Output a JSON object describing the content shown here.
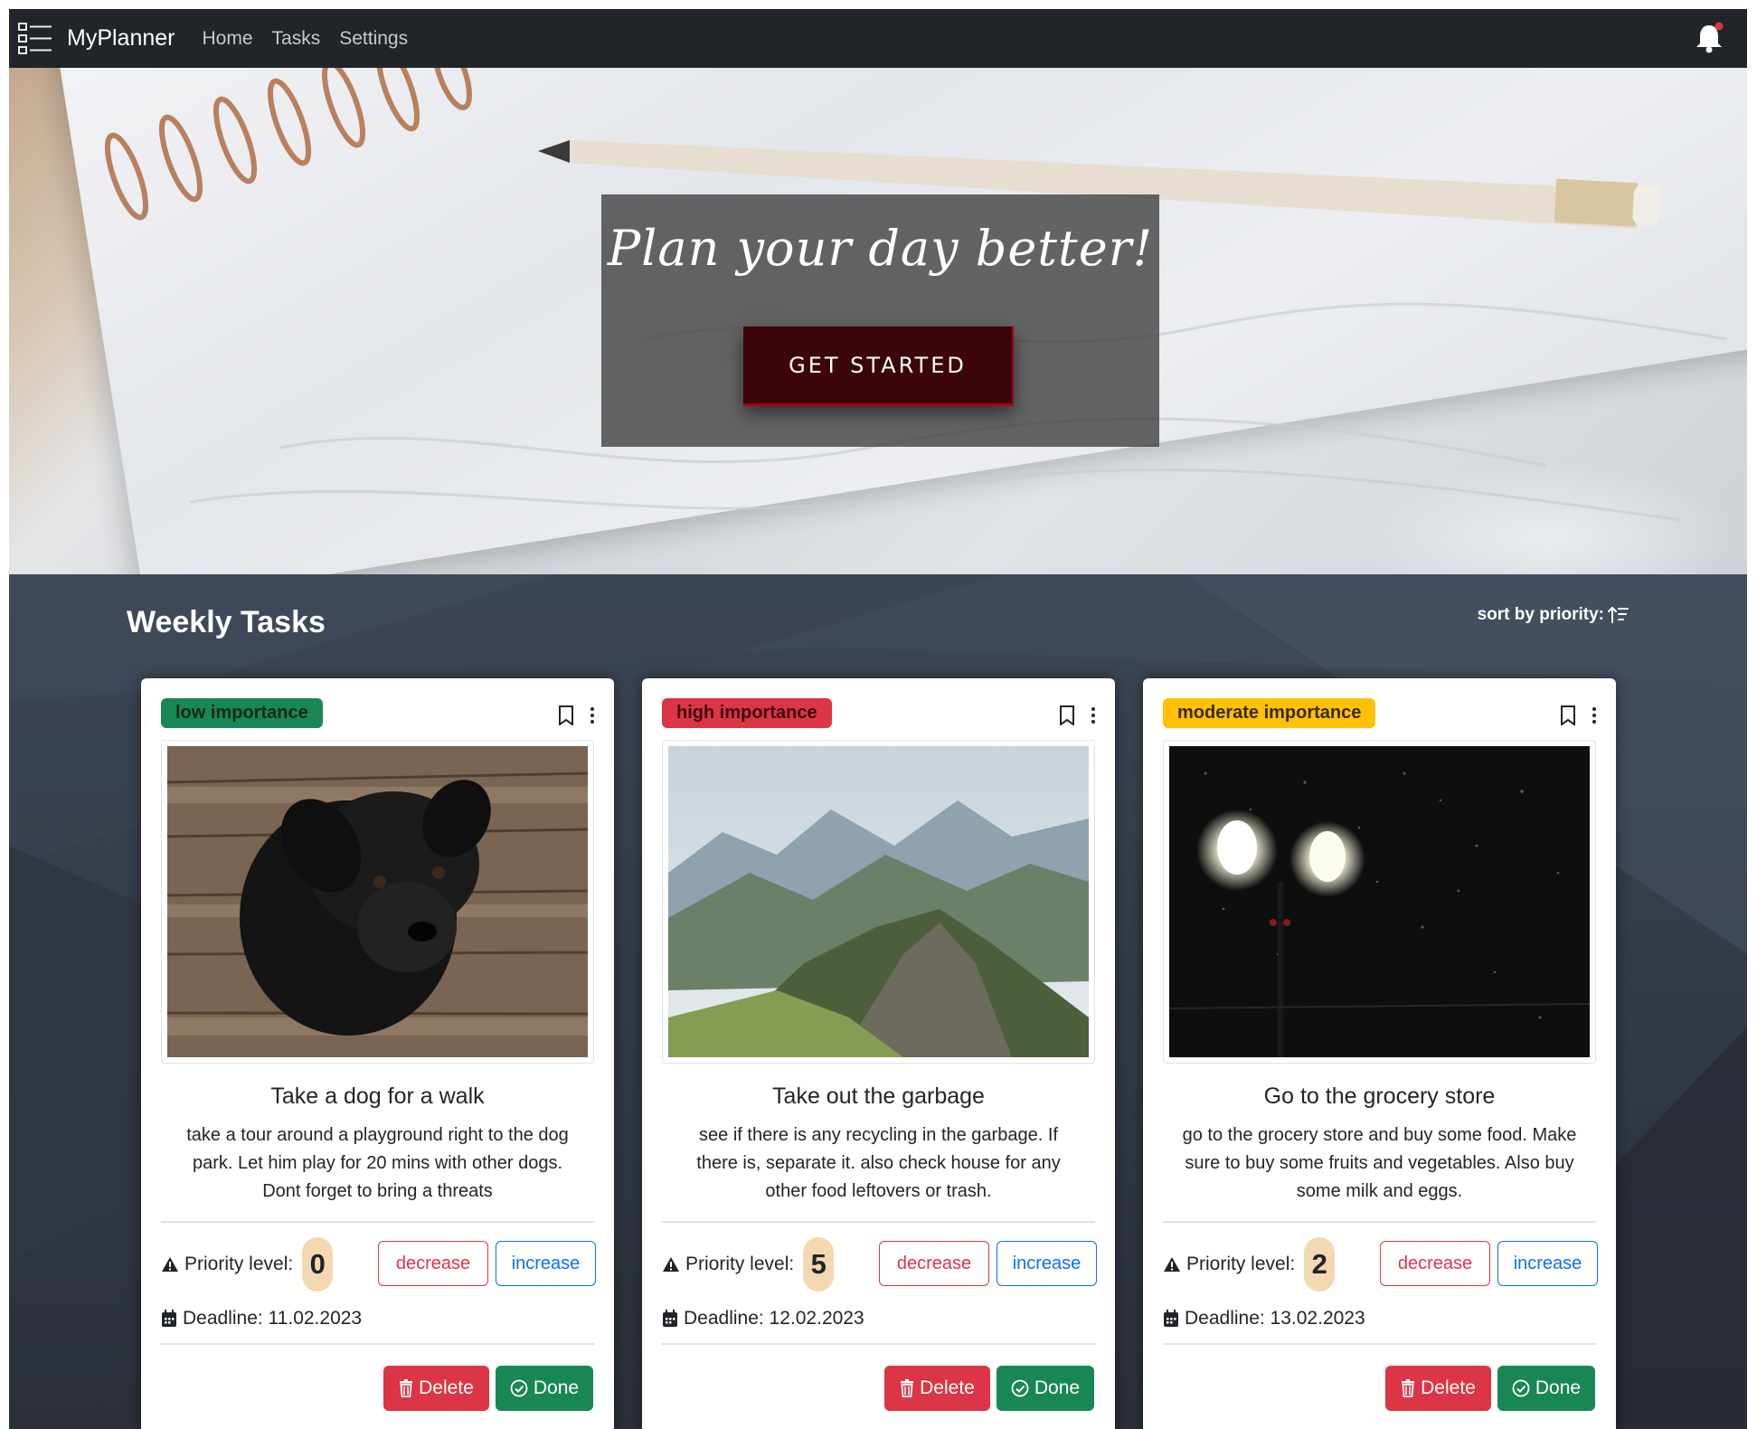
{
  "navbar": {
    "brand": "MyPlanner",
    "links": [
      "Home",
      "Tasks",
      "Settings"
    ],
    "icons": {
      "menu": "list-menu-icon",
      "notifications": "bell-icon"
    },
    "colors": {
      "background": "#212529",
      "notification_dot": "#dc3545"
    }
  },
  "hero": {
    "title": "Plan your day better!",
    "cta_label": "GET STARTED"
  },
  "tasks_section": {
    "title": "Weekly Tasks",
    "sort_label": "sort by priority:",
    "sort_icon": "sort-ascending-icon"
  },
  "labels": {
    "priority": "Priority level:",
    "decrease": "decrease",
    "increase": "increase",
    "delete": "Delete",
    "done": "Done"
  },
  "cards": [
    {
      "importance": "low importance",
      "importance_color": "#198754",
      "image": "black-puppy-on-wooden-floor",
      "title": "Take a dog for a walk",
      "description": "take a tour around a playground right to the dog park. Let him play for 20 mins with other dogs. Dont forget to bring a threats",
      "priority": "0",
      "deadline": "Deadline: 11.02.2023"
    },
    {
      "importance": "high importance",
      "importance_color": "#dc3545",
      "image": "mountain-ridge-landscape",
      "title": "Take out the garbage",
      "description": "see if there is any recycling in the garbage. If there is, separate it. also check house for any other food leftovers or trash.",
      "priority": "5",
      "deadline": "Deadline: 12.02.2023"
    },
    {
      "importance": "moderate importance",
      "importance_color": "#ffc107",
      "image": "street-lamps-in-snowy-night",
      "title": "Go to the grocery store",
      "description": "go to the grocery store and buy some food. Make sure to buy some fruits and vegetables. Also buy some milk and eggs.",
      "priority": "2",
      "deadline": "Deadline: 13.02.2023"
    }
  ]
}
